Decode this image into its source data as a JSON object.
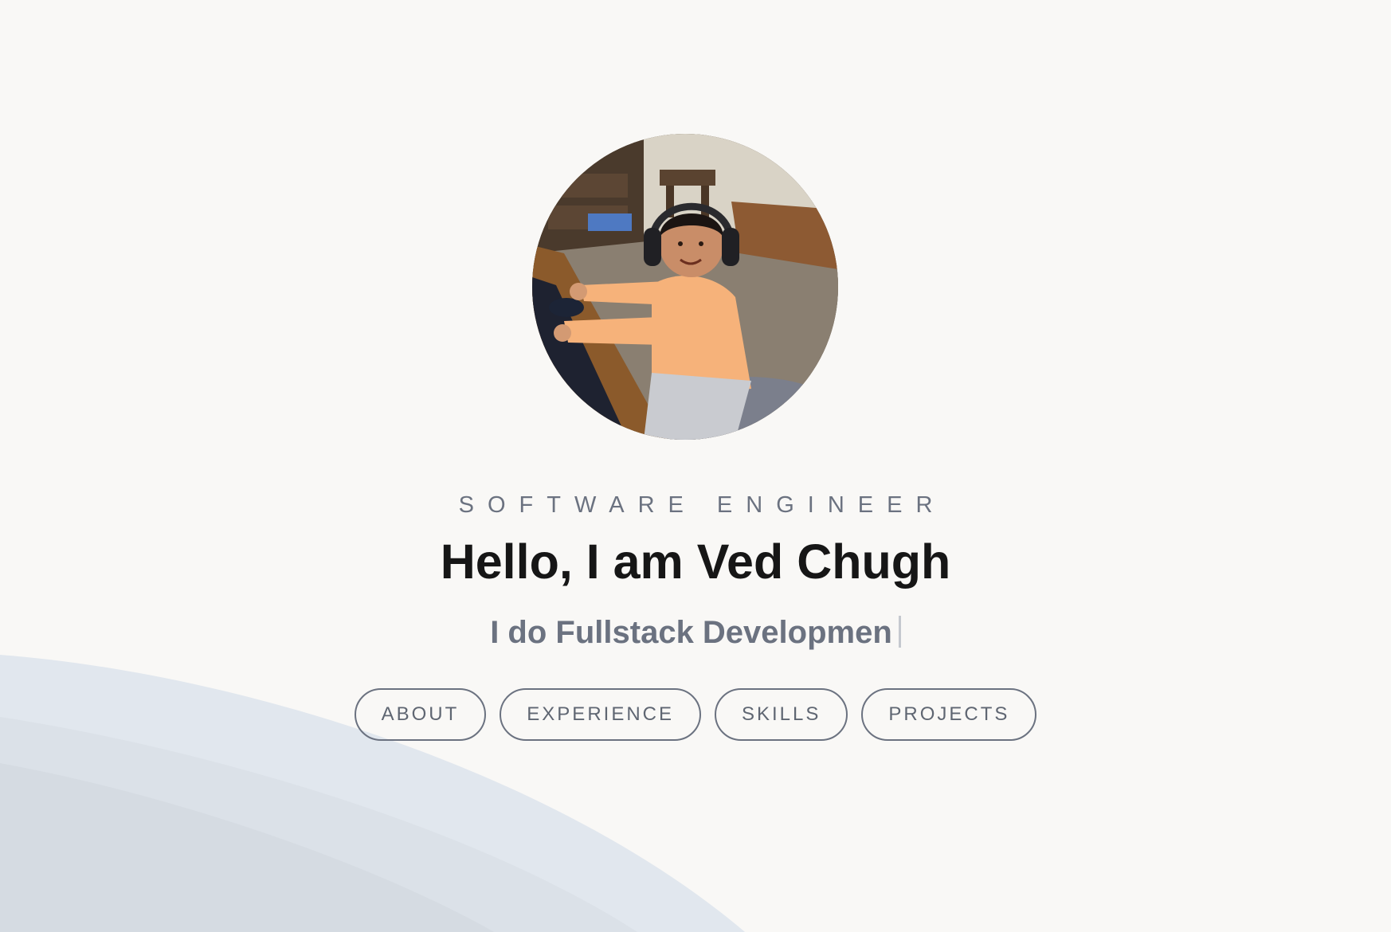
{
  "hero": {
    "role": "SOFTWARE ENGINEER",
    "greeting": "Hello, I am Ved Chugh",
    "typing_text": "I do Fullstack Developmen"
  },
  "nav": {
    "items": [
      {
        "label": "ABOUT"
      },
      {
        "label": "EXPERIENCE"
      },
      {
        "label": "SKILLS"
      },
      {
        "label": "PROJECTS"
      }
    ]
  },
  "colors": {
    "background": "#f9f8f6",
    "wave_light": "#e1e7ee",
    "wave_mid": "#dbe1e8",
    "wave_dark": "#d5dbe2",
    "text_primary": "#161616",
    "text_muted": "#6b7280",
    "button_border": "#6b7280"
  }
}
